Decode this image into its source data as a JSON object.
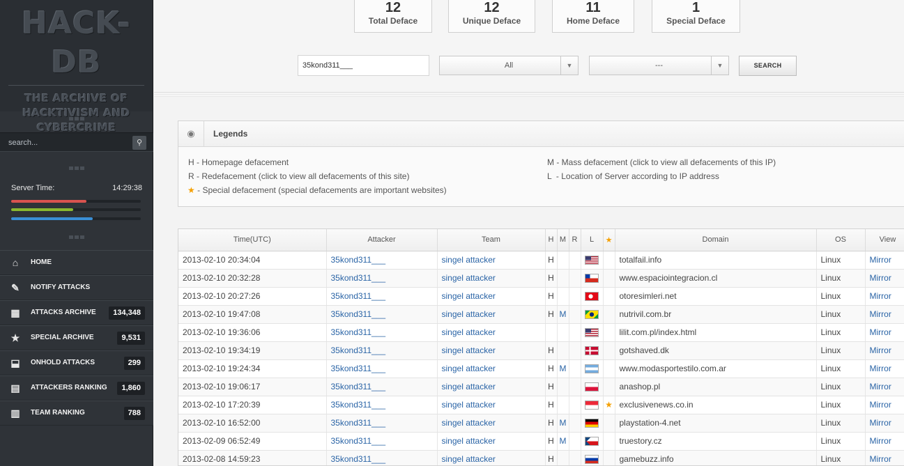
{
  "sidebar": {
    "logo_title": "HACK-DB",
    "logo_sub": [
      "THE ARCHIVE OF",
      "HACKTIVISM AND",
      "CYBERCRIME"
    ],
    "search_placeholder": "search...",
    "server_time_label": "Server Time:",
    "server_time": "14:29:38",
    "bars": [
      {
        "color": "#d9534f",
        "fraction": 0.58
      },
      {
        "color": "#8ab830",
        "fraction": 0.48
      },
      {
        "color": "#3a8fd6",
        "fraction": 0.63
      }
    ],
    "nav": [
      {
        "icon": "home-icon",
        "glyph": "⌂",
        "label": "HOME",
        "count": ""
      },
      {
        "icon": "pencil-icon",
        "glyph": "✎",
        "label": "NOTIFY ATTACKS",
        "count": ""
      },
      {
        "icon": "dashboard-icon",
        "glyph": "▦",
        "label": "ATTACKS ARCHIVE",
        "count": "134,348"
      },
      {
        "icon": "star-icon",
        "glyph": "★",
        "label": "SPECIAL ARCHIVE",
        "count": "9,531"
      },
      {
        "icon": "inbox-icon",
        "glyph": "⬓",
        "label": "ONHOLD ATTACKS",
        "count": "299"
      },
      {
        "icon": "ranking-icon",
        "glyph": "▤",
        "label": "ATTACKERS RANKING",
        "count": "1,860"
      },
      {
        "icon": "bar-chart-icon",
        "glyph": "▥",
        "label": "TEAM RANKING",
        "count": "788"
      }
    ]
  },
  "stats": [
    {
      "value": "12",
      "label": "Total Deface"
    },
    {
      "value": "12",
      "label": "Unique Deface"
    },
    {
      "value": "11",
      "label": "Home Deface"
    },
    {
      "value": "1",
      "label": "Special Deface"
    }
  ],
  "filters": {
    "query": "35kond311___",
    "select1": "All",
    "select2": "---",
    "search_button": "SEARCH"
  },
  "legends": {
    "title": "Legends",
    "left": [
      {
        "key": "H",
        "text": "- Homepage defacement"
      },
      {
        "key": "R",
        "text": "- Redefacement (click to view all defacements of this site)"
      },
      {
        "key": "★",
        "text": "- Special defacement (special defacements are important websites)"
      }
    ],
    "right": [
      {
        "key": "M",
        "text": "- Mass defacement (click to view all defacements of this IP)"
      },
      {
        "key": "L",
        "text": "- Location of Server according to IP address"
      }
    ]
  },
  "table": {
    "headers": [
      "Time(UTC)",
      "Attacker",
      "Team",
      "H",
      "M",
      "R",
      "L",
      "★",
      "Domain",
      "OS",
      "View"
    ],
    "rows": [
      {
        "time": "2013-02-10 20:34:04",
        "attacker": "35kond311___",
        "team": "singel attacker",
        "h": "H",
        "m": "",
        "r": "",
        "flag": "us",
        "special": "",
        "domain": "totalfail.info",
        "os": "Linux",
        "view": "Mirror"
      },
      {
        "time": "2013-02-10 20:32:28",
        "attacker": "35kond311___",
        "team": "singel attacker",
        "h": "H",
        "m": "",
        "r": "",
        "flag": "cl",
        "special": "",
        "domain": "www.espaciointegracion.cl",
        "os": "Linux",
        "view": "Mirror"
      },
      {
        "time": "2013-02-10 20:27:26",
        "attacker": "35kond311___",
        "team": "singel attacker",
        "h": "H",
        "m": "",
        "r": "",
        "flag": "tr",
        "special": "",
        "domain": "otoresimleri.net",
        "os": "Linux",
        "view": "Mirror"
      },
      {
        "time": "2013-02-10 19:47:08",
        "attacker": "35kond311___",
        "team": "singel attacker",
        "h": "H",
        "m": "M",
        "r": "",
        "flag": "br",
        "special": "",
        "domain": "nutrivil.com.br",
        "os": "Linux",
        "view": "Mirror"
      },
      {
        "time": "2013-02-10 19:36:06",
        "attacker": "35kond311___",
        "team": "singel attacker",
        "h": "",
        "m": "",
        "r": "",
        "flag": "us",
        "special": "",
        "domain": "lilit.com.pl/index.html",
        "os": "Linux",
        "view": "Mirror"
      },
      {
        "time": "2013-02-10 19:34:19",
        "attacker": "35kond311___",
        "team": "singel attacker",
        "h": "H",
        "m": "",
        "r": "",
        "flag": "dk",
        "special": "",
        "domain": "gotshaved.dk",
        "os": "Linux",
        "view": "Mirror"
      },
      {
        "time": "2013-02-10 19:24:34",
        "attacker": "35kond311___",
        "team": "singel attacker",
        "h": "H",
        "m": "M",
        "r": "",
        "flag": "ar",
        "special": "",
        "domain": "www.modasportestilo.com.ar",
        "os": "Linux",
        "view": "Mirror"
      },
      {
        "time": "2013-02-10 19:06:17",
        "attacker": "35kond311___",
        "team": "singel attacker",
        "h": "H",
        "m": "",
        "r": "",
        "flag": "pl",
        "special": "",
        "domain": "anashop.pl",
        "os": "Linux",
        "view": "Mirror"
      },
      {
        "time": "2013-02-10 17:20:39",
        "attacker": "35kond311___",
        "team": "singel attacker",
        "h": "H",
        "m": "",
        "r": "",
        "flag": "sg",
        "special": "★",
        "domain": "exclusivenews.co.in",
        "os": "Linux",
        "view": "Mirror"
      },
      {
        "time": "2013-02-10 16:52:00",
        "attacker": "35kond311___",
        "team": "singel attacker",
        "h": "H",
        "m": "M",
        "r": "",
        "flag": "de",
        "special": "",
        "domain": "playstation-4.net",
        "os": "Linux",
        "view": "Mirror"
      },
      {
        "time": "2013-02-09 06:52:49",
        "attacker": "35kond311___",
        "team": "singel attacker",
        "h": "H",
        "m": "M",
        "r": "",
        "flag": "cz",
        "special": "",
        "domain": "truestory.cz",
        "os": "Linux",
        "view": "Mirror"
      },
      {
        "time": "2013-02-08 14:59:23",
        "attacker": "35kond311___",
        "team": "singel attacker",
        "h": "H",
        "m": "",
        "r": "",
        "flag": "ru",
        "special": "",
        "domain": "gamebuzz.info",
        "os": "Linux",
        "view": "Mirror"
      }
    ]
  }
}
